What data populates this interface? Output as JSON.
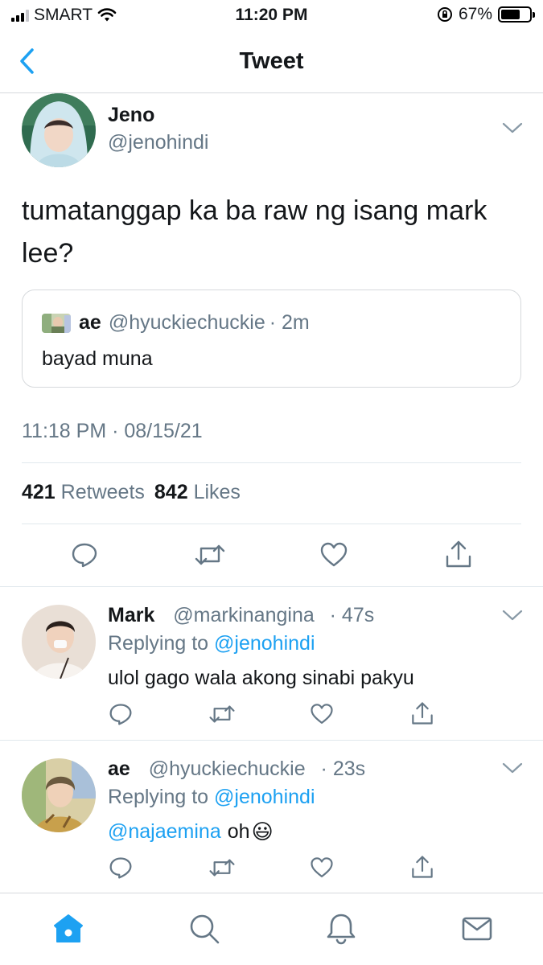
{
  "status": {
    "carrier": "SMART",
    "time": "11:20 PM",
    "battery": "67%",
    "battery_level": 0.67
  },
  "nav": {
    "title": "Tweet"
  },
  "tweet": {
    "author": {
      "name": "Jeno",
      "handle": "@jenohindi"
    },
    "text": "tumatanggap ka ba raw ng isang mark lee?",
    "quote": {
      "name": "ae",
      "handle": "@hyuckiechuckie",
      "time": "· 2m",
      "text": "bayad muna"
    },
    "timestamp": "11:18 PM · 08/15/21",
    "stats": {
      "retweets": "421",
      "retweets_label": "Retweets",
      "likes": "842",
      "likes_label": "Likes"
    }
  },
  "replies": [
    {
      "name": "Mark",
      "handle": "@markinangina",
      "time": "· 47s",
      "replying_prefix": "Replying to",
      "replying_to": "@jenohindi",
      "text": "ulol gago wala akong sinabi pakyu"
    },
    {
      "name": "ae",
      "handle": "@hyuckiechuckie",
      "time": "· 23s",
      "replying_prefix": "Replying to",
      "replying_to": "@jenohindi",
      "mention": "@najaemina",
      "text": "oh",
      "emoji": "😃"
    }
  ],
  "tabs": [
    "home-icon",
    "search-icon",
    "bell-icon",
    "mail-icon"
  ],
  "colors": {
    "accent": "#1da1f2",
    "muted": "#657786",
    "divider": "#e1e8ed"
  }
}
